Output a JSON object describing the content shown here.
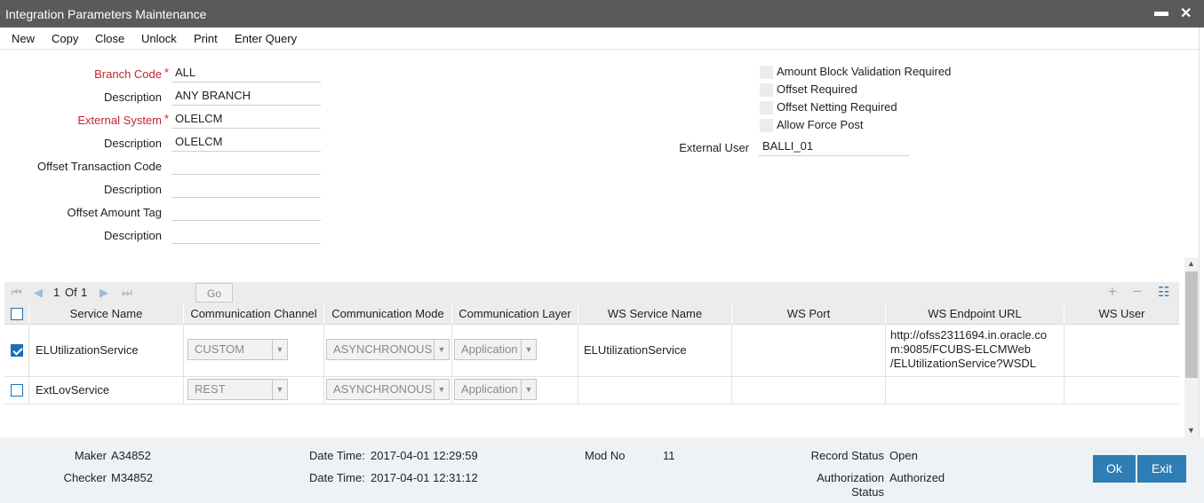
{
  "window": {
    "title": "Integration Parameters Maintenance",
    "minimize": "▬",
    "close": "✕"
  },
  "menu": [
    "New",
    "Copy",
    "Close",
    "Unlock",
    "Print",
    "Enter Query"
  ],
  "form": {
    "branch_code_label": "Branch Code",
    "branch_code": "ALL",
    "desc1_label": "Description",
    "desc1": "ANY BRANCH",
    "external_system_label": "External System",
    "external_system": "OLELCM",
    "desc2_label": "Description",
    "desc2": "OLELCM",
    "offset_txn_label": "Offset Transaction Code",
    "offset_txn": "",
    "desc3_label": "Description",
    "desc3": "",
    "offset_amt_label": "Offset Amount Tag",
    "offset_amt": "",
    "desc4_label": "Description",
    "desc4": "",
    "required_mark": "*",
    "amount_block_label": "Amount Block Validation Required",
    "offset_required_label": "Offset Required",
    "offset_netting_label": "Offset Netting Required",
    "allow_force_post_label": "Allow Force Post",
    "external_user_label": "External User",
    "external_user": "BALLI_01"
  },
  "pager": {
    "current": "1",
    "of_label": "Of",
    "total": "1",
    "go": "Go",
    "add": "+",
    "remove": "−",
    "columns": "☷"
  },
  "table": {
    "headers": [
      "Service Name",
      "Communication Channel",
      "Communication Mode",
      "Communication Layer",
      "WS Service Name",
      "WS Port",
      "WS Endpoint URL",
      "WS User"
    ],
    "rows": [
      {
        "checked": true,
        "service": "ELUtilizationService",
        "channel": "CUSTOM",
        "mode": "ASYNCHRONOUS",
        "layer": "Application",
        "ws_service": "ELUtilizationService",
        "ws_port": "",
        "url1": "http://ofss2311694.in.oracle.co",
        "url2": "m:9085/FCUBS-ELCMWeb",
        "url3": "/ELUtilizationService?WSDL",
        "ws_user": ""
      },
      {
        "checked": false,
        "service": "ExtLovService",
        "channel": "REST",
        "mode": "ASYNCHRONOUS",
        "layer": "Application",
        "ws_service": "",
        "ws_port": "",
        "url1": "",
        "url2": "",
        "url3": "",
        "ws_user": ""
      }
    ]
  },
  "footer": {
    "maker_label": "Maker",
    "maker": "A34852",
    "checker_label": "Checker",
    "checker": "M34852",
    "dt_label": "Date Time:",
    "maker_dt": "2017-04-01 12:29:59",
    "checker_dt": "2017-04-01 12:31:12",
    "mod_label": "Mod No",
    "mod_no": "11",
    "record_status_label": "Record Status",
    "record_status": "Open",
    "auth_status_label1": "Authorization",
    "auth_status_label2": "Status",
    "auth_status": "Authorized",
    "ok": "Ok",
    "exit": "Exit"
  }
}
